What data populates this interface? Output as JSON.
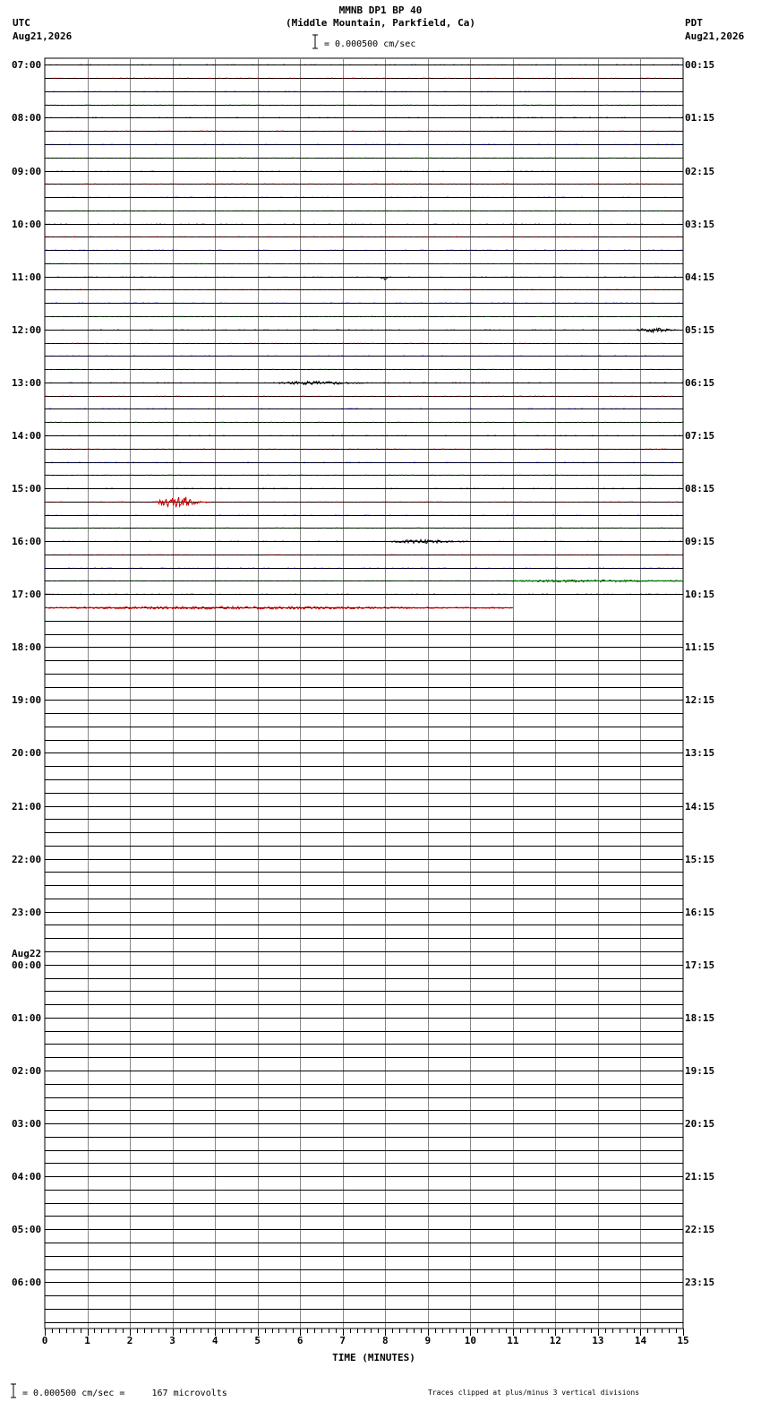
{
  "header": {
    "title": "MMNB DP1 BP 40",
    "subtitle": "(Middle Mountain, Parkfield, Ca)",
    "scale_text": "= 0.000500 cm/sec",
    "left_tz": "UTC",
    "left_date": "Aug21,2026",
    "right_tz": "PDT",
    "right_date": "Aug21,2026"
  },
  "footer": {
    "scale_text": "= 0.000500 cm/sec =     167 microvolts",
    "clip_note": "Traces clipped at plus/minus 3 vertical divisions"
  },
  "chart_data": {
    "type": "line",
    "xlabel": "TIME (MINUTES)",
    "x_ticks": [
      "0",
      "1",
      "2",
      "3",
      "4",
      "5",
      "6",
      "7",
      "8",
      "9",
      "10",
      "11",
      "12",
      "13",
      "14",
      "15"
    ],
    "xlim": [
      0,
      15
    ],
    "grid": true,
    "utc_labels": [
      "07:00",
      "08:00",
      "09:00",
      "10:00",
      "11:00",
      "12:00",
      "13:00",
      "14:00",
      "15:00",
      "16:00",
      "17:00",
      "18:00",
      "19:00",
      "20:00",
      "21:00",
      "22:00",
      "23:00",
      "00:00",
      "01:00",
      "02:00",
      "03:00",
      "04:00",
      "05:00",
      "06:00"
    ],
    "date_change_label": "Aug22",
    "pdt_labels": [
      "00:15",
      "01:15",
      "02:15",
      "03:15",
      "04:15",
      "05:15",
      "06:15",
      "07:15",
      "08:15",
      "09:15",
      "10:15",
      "11:15",
      "12:15",
      "13:15",
      "14:15",
      "15:15",
      "16:15",
      "17:15",
      "18:15",
      "19:15",
      "20:15",
      "21:15",
      "22:15",
      "23:15"
    ],
    "trace_colors": [
      "#000000",
      "#cc0000",
      "#0000cc",
      "#008000"
    ],
    "traces_recorded": 42,
    "events": [
      {
        "trace": 16,
        "x_start": 7.9,
        "x_end": 8.1,
        "amp": 2
      },
      {
        "trace": 20,
        "x_start": 13.9,
        "x_end": 14.9,
        "amp": 2
      },
      {
        "trace": 24,
        "x_start": 5.5,
        "x_end": 7.5,
        "amp": 1.5
      },
      {
        "trace": 33,
        "x_start": 2.6,
        "x_end": 3.9,
        "amp": 6
      },
      {
        "trace": 36,
        "x_start": 8.1,
        "x_end": 10.0,
        "amp": 1.5
      },
      {
        "trace": 39,
        "x_start": 11.0,
        "x_end": 15.0,
        "amp": 1
      },
      {
        "trace": 41,
        "x_start": 0.0,
        "x_end": 11.0,
        "amp": 1
      }
    ]
  }
}
